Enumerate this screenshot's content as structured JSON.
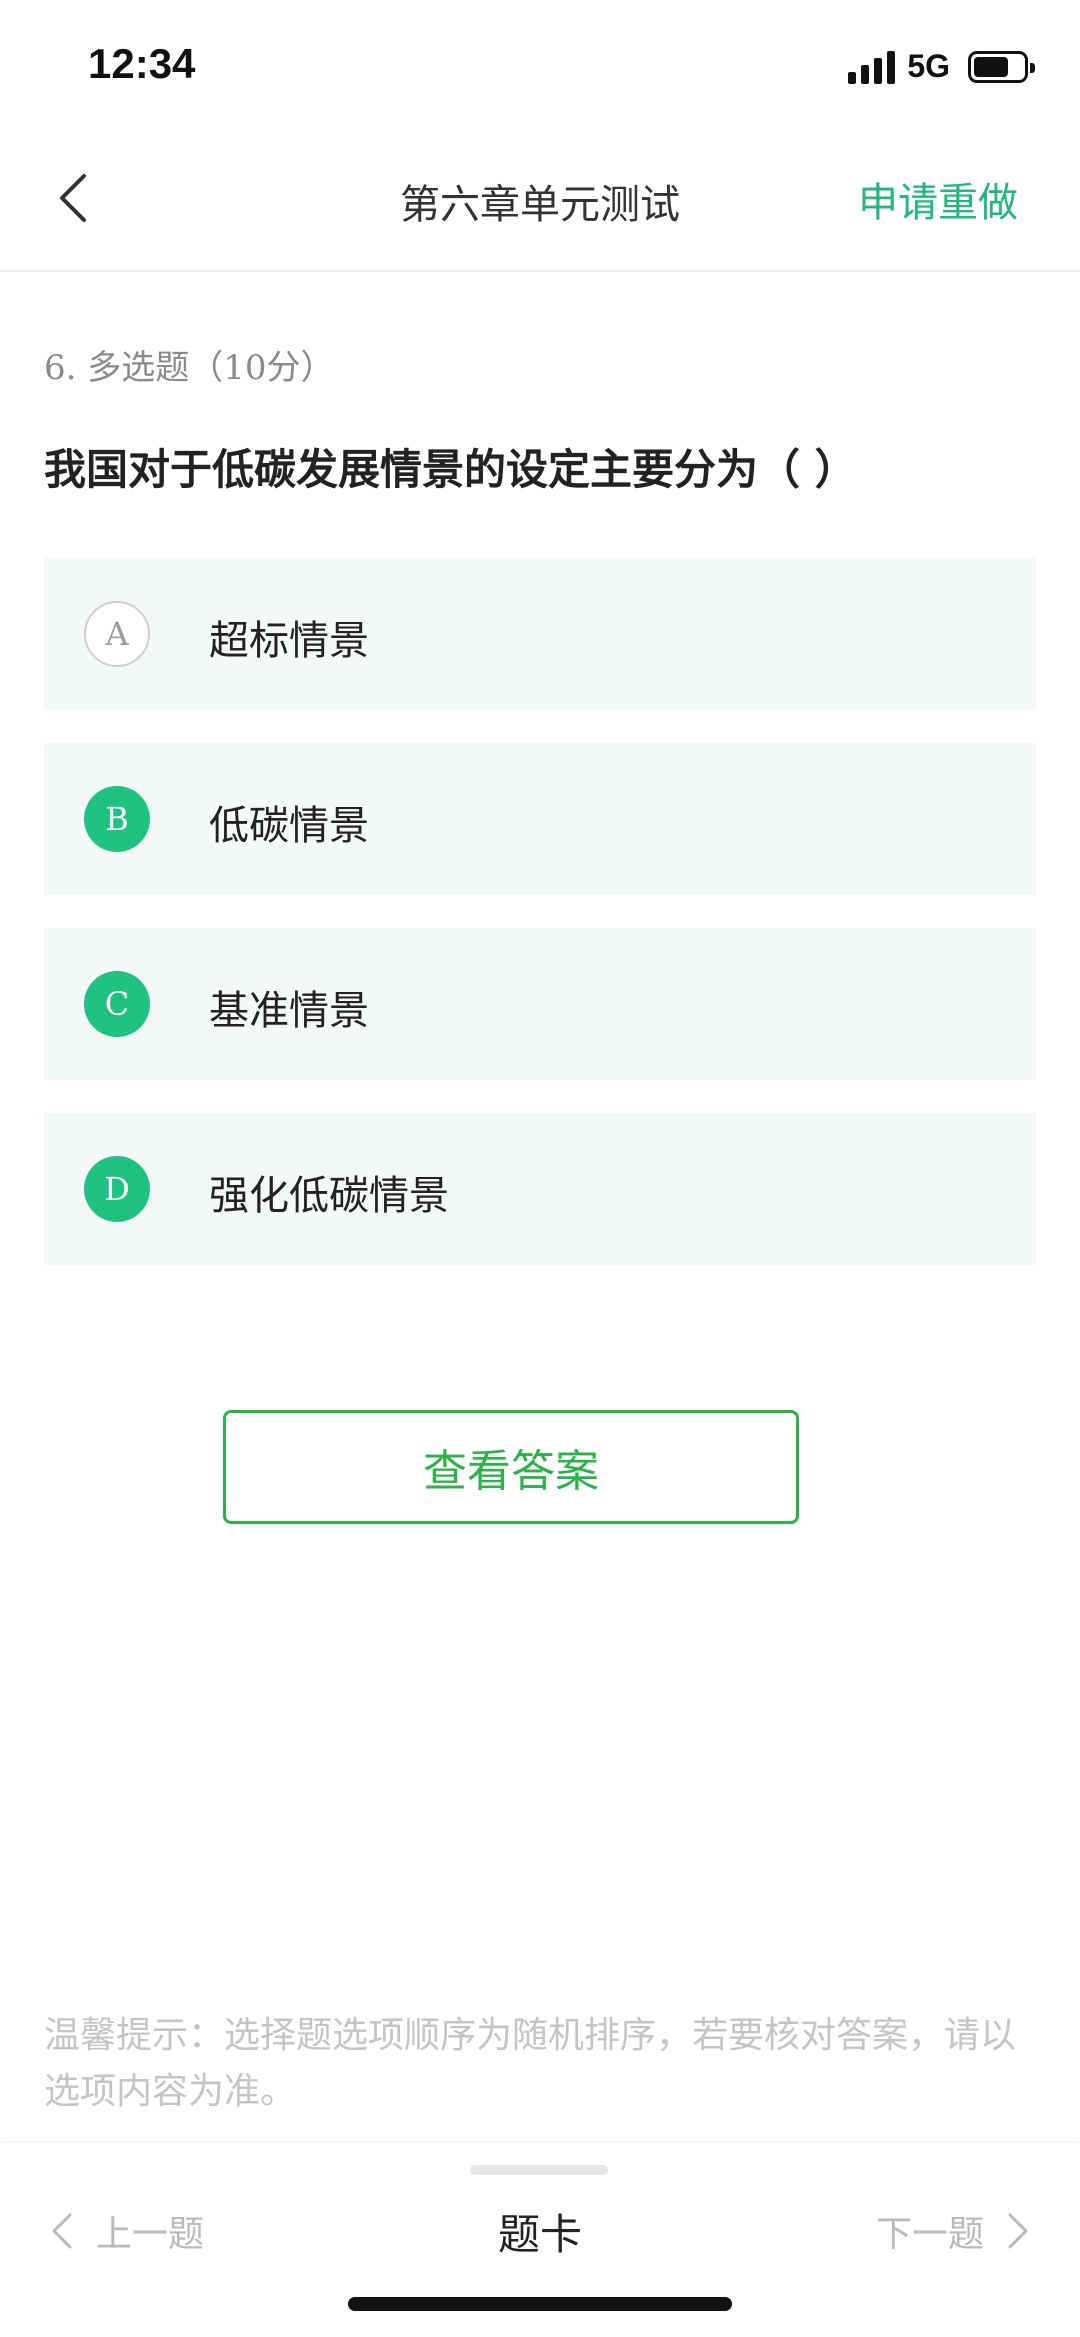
{
  "status_bar": {
    "time": "12:34",
    "network": "5G",
    "battery_level": 0.7
  },
  "header": {
    "title": "第六章单元测试",
    "redo_label": "申请重做",
    "back_icon": "chevron-left-icon"
  },
  "question": {
    "meta": "6. 多选题（10分）",
    "text": "我国对于低碳发展情景的设定主要分为（ ）"
  },
  "options": [
    {
      "letter": "A",
      "text": "超标情景",
      "selected": false
    },
    {
      "letter": "B",
      "text": "低碳情景",
      "selected": true
    },
    {
      "letter": "C",
      "text": "基准情景",
      "selected": true
    },
    {
      "letter": "D",
      "text": "强化低碳情景",
      "selected": true
    }
  ],
  "view_answer_label": "查看答案",
  "tip": "温馨提示：选择题选项顺序为随机排序，若要核对答案，请以选项内容为准。",
  "bottom_nav": {
    "prev_label": "上一题",
    "card_label": "题卡",
    "next_label": "下一题"
  },
  "colors": {
    "accent": "#20b97a",
    "selected": "#20c281",
    "answer_button": "#2bb34a",
    "option_bg": "#f4f8f8"
  }
}
